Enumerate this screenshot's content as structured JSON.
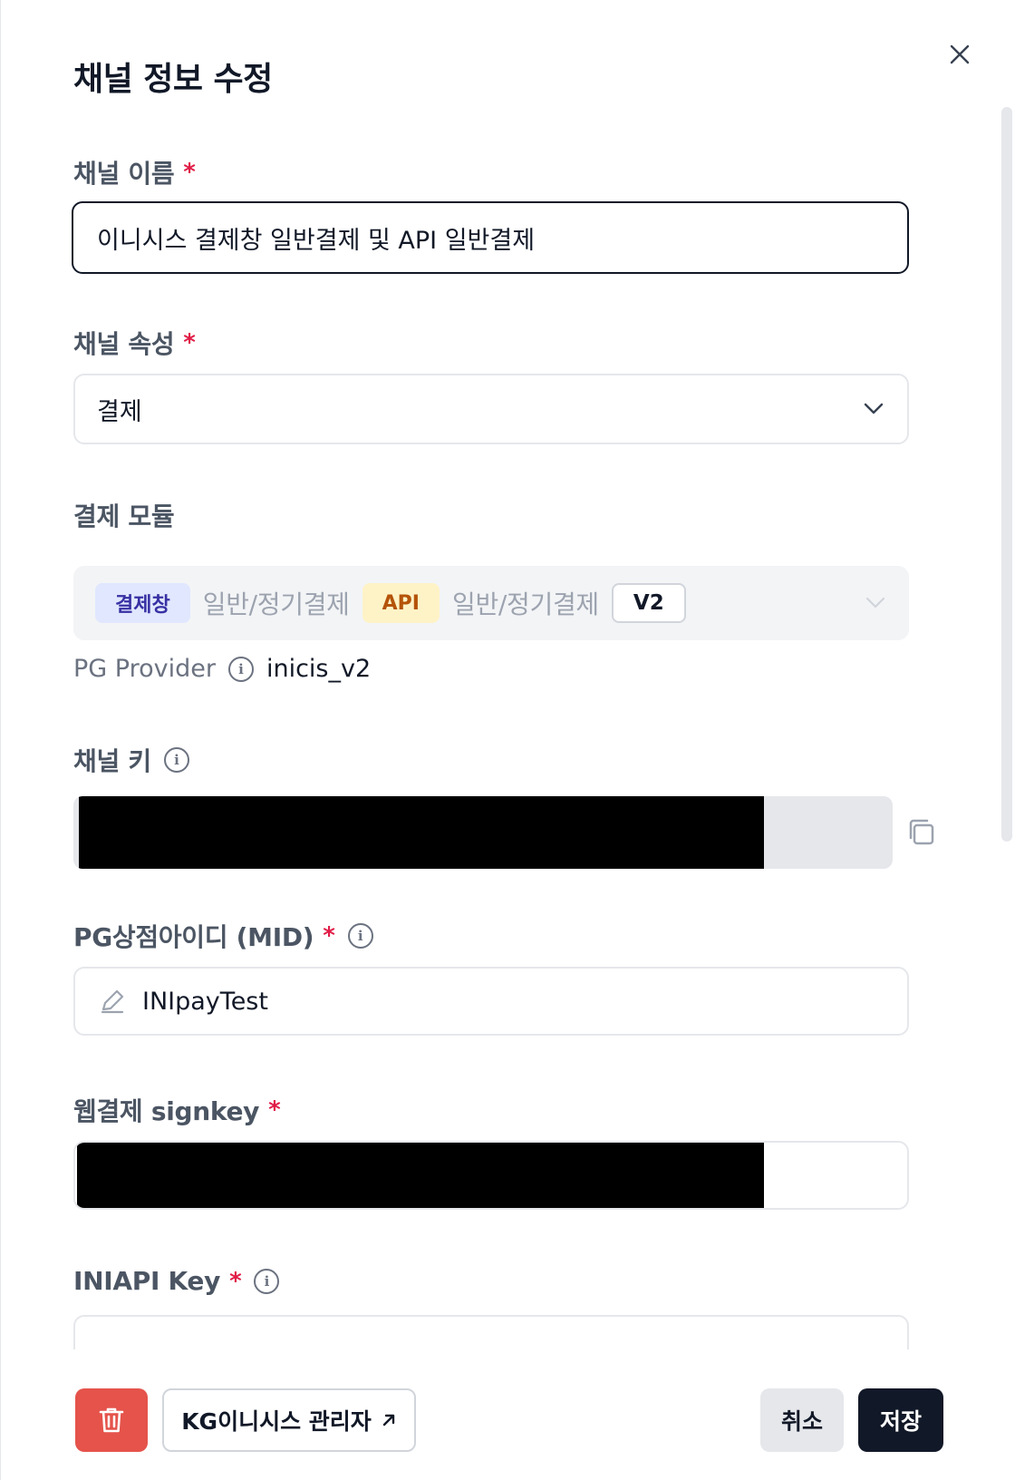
{
  "dialog": {
    "title": "채널 정보 수정"
  },
  "fields": {
    "channel_name": {
      "label": "채널 이름",
      "required_mark": "*",
      "value": "이니시스 결제창 일반결제 및 API 일반결제"
    },
    "channel_attribute": {
      "label": "채널 속성",
      "required_mark": "*",
      "value": "결제"
    },
    "payment_module": {
      "label": "결제 모듈",
      "chip_1": "결제창",
      "text_1": "일반/정기결제",
      "chip_2": "API",
      "text_2": "일반/정기결제",
      "chip_3": "V2"
    },
    "pg_provider": {
      "key": "PG Provider",
      "value": "inicis_v2"
    },
    "channel_key": {
      "label": "채널 키"
    },
    "mid": {
      "label": "PG상점아이디 (MID)",
      "required_mark": "*",
      "value": "INIpayTest"
    },
    "web_signkey": {
      "label": "웹결제 signkey",
      "required_mark": "*"
    },
    "iniapi_key": {
      "label": "INIAPI Key",
      "required_mark": "*"
    }
  },
  "footer": {
    "kg_admin_label": "KG이니시스 관리자",
    "cancel_label": "취소",
    "save_label": "저장"
  },
  "colors": {
    "required": "#e11d48",
    "delete": "#e5534b",
    "primary": "#111827"
  },
  "icons": [
    "close-icon",
    "chevron-down-icon",
    "info-icon",
    "copy-icon",
    "pencil-icon",
    "trash-icon",
    "external-link-icon"
  ]
}
